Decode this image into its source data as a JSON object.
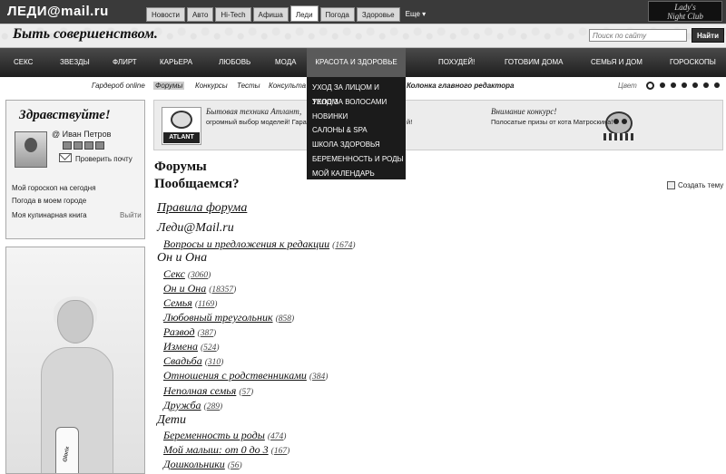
{
  "header": {
    "logo": "ЛЕДИ@mail.ru",
    "tabs": [
      "Новости",
      "Авто",
      "Hi-Tech",
      "Афиша",
      "Леди",
      "Погода",
      "Здоровье"
    ],
    "active_tab": "Леди",
    "more_label": "Еще ▾",
    "badge_line1": "Lady's",
    "badge_line2": "Night Club"
  },
  "banner": {
    "slogan": "Быть совершенством.",
    "search_placeholder": "Поиск по сайту",
    "search_button": "Найти"
  },
  "main_menu": {
    "items": [
      "СЕКС",
      "ЗВЕЗДЫ",
      "ФЛИРТ",
      "КАРЬЕРА",
      "ЛЮБОВЬ",
      "МОДА",
      "КРАСОТА И ЗДОРОВЬЕ",
      "ПОХУДЕЙ!",
      "ГОТОВИМ ДОМА",
      "СЕМЬЯ И ДОМ",
      "ГОРОСКОПЫ"
    ],
    "active_item": "КРАСОТА И ЗДОРОВЬЕ"
  },
  "dropdown": {
    "items": [
      "УХОД ЗА ЛИЦОМ И ТЕЛОМ",
      "УХОД ЗА ВОЛОСАМИ",
      "НОВИНКИ",
      "САЛОНЫ & SPA",
      "ШКОЛА ЗДОРОВЬЯ",
      "БЕРЕМЕННОСТЬ И РОДЫ",
      "МОЙ КАЛЕНДАРЬ"
    ]
  },
  "subnav": {
    "items": [
      "Гардероб online",
      "Форумы",
      "Конкурсы",
      "Тесты",
      "Консульта",
      "Колонка главного редактора"
    ],
    "active_item": "Форумы",
    "color_label": "Цвет",
    "color_dots": 7,
    "selected_dot": 0
  },
  "sidebar": {
    "hello": "Здравствуйте!",
    "user_name": "@ Иван Петров",
    "check_mail": "Проверить почту",
    "links": [
      "Мой гороскоп на сегодня",
      "Погода в моем городе",
      "Моя кулинарная книга"
    ],
    "logout": "Выйти",
    "ad_product": "Glorix"
  },
  "promo": {
    "left_logo": "ATLANT",
    "left_title": "Бытовая техника Атлант,",
    "left_text": "огромный выбор моделей! Гарант",
    "left_text_tail": "й!",
    "right_title": "Внимание конкурс!",
    "right_text": "Полосатые призы от кота Матроскина!"
  },
  "forums": {
    "heading_line1": "Форумы",
    "heading_line2": "Пообщаемся?",
    "create_topic": "Создать тему",
    "rules": "Правила форума",
    "groups": [
      {
        "title": "Леди@Mail.ru",
        "items": [
          {
            "name": "Вопросы и предложения к редакции",
            "count": "1674"
          }
        ]
      },
      {
        "title": "Он и Она",
        "items": [
          {
            "name": "Секс",
            "count": "3060"
          },
          {
            "name": "Он и Она",
            "count": "18357"
          },
          {
            "name": "Семья",
            "count": "1169"
          },
          {
            "name": "Любовный треугольник",
            "count": "858"
          },
          {
            "name": "Развод",
            "count": "387"
          },
          {
            "name": "Измена",
            "count": "524"
          },
          {
            "name": "Свадьба",
            "count": "310"
          },
          {
            "name": "Отношения с родственниками",
            "count": "384"
          },
          {
            "name": "Неполная семья",
            "count": "57"
          },
          {
            "name": "Дружба",
            "count": "289"
          }
        ]
      },
      {
        "title": "Дети",
        "items": [
          {
            "name": "Беременность и роды",
            "count": "474"
          },
          {
            "name": "Мой малыш: от 0 до 3",
            "count": "167"
          },
          {
            "name": "Дошкольники",
            "count": "56"
          }
        ]
      }
    ]
  }
}
